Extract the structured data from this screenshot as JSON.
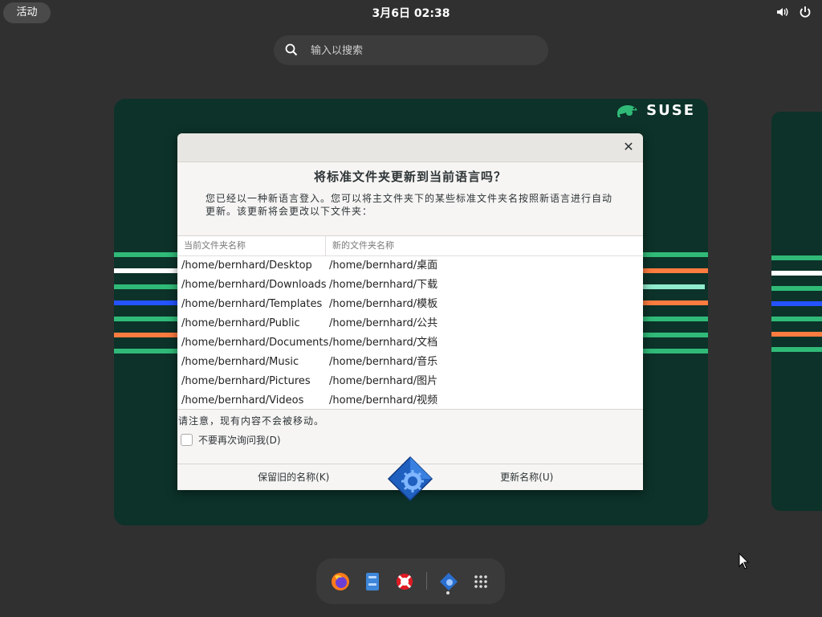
{
  "topbar": {
    "activities": "活动",
    "clock": "3月6日 02:38"
  },
  "search": {
    "placeholder": "输入以搜索"
  },
  "workspace": {
    "brand": "SUSE"
  },
  "dialog": {
    "title": "将标准文件夹更新到当前语言吗？",
    "description": "您已经以一种新语言登入。您可以将主文件夹下的某些标准文件夹名按照新语言进行自动更新。该更新将会更改以下文件夹：",
    "col_current": "当前文件夹名称",
    "col_new": "新的文件夹名称",
    "rows": [
      {
        "current": "/home/bernhard/Desktop",
        "new": "/home/bernhard/桌面"
      },
      {
        "current": "/home/bernhard/Downloads",
        "new": "/home/bernhard/下载"
      },
      {
        "current": "/home/bernhard/Templates",
        "new": "/home/bernhard/模板"
      },
      {
        "current": "/home/bernhard/Public",
        "new": "/home/bernhard/公共"
      },
      {
        "current": "/home/bernhard/Documents",
        "new": "/home/bernhard/文档"
      },
      {
        "current": "/home/bernhard/Music",
        "new": "/home/bernhard/音乐"
      },
      {
        "current": "/home/bernhard/Pictures",
        "new": "/home/bernhard/图片"
      },
      {
        "current": "/home/bernhard/Videos",
        "new": "/home/bernhard/视频"
      }
    ],
    "note": "请注意，现有内容不会被移动。",
    "checkbox_label": "不要再次询问我(D)",
    "checkbox_checked": false,
    "keep_button": "保留旧的名称(K)",
    "update_button": "更新名称(U)"
  },
  "dock": {
    "items": [
      "firefox-icon",
      "files-icon",
      "help-icon",
      "user-dirs-update-icon",
      "show-apps-icon"
    ]
  }
}
